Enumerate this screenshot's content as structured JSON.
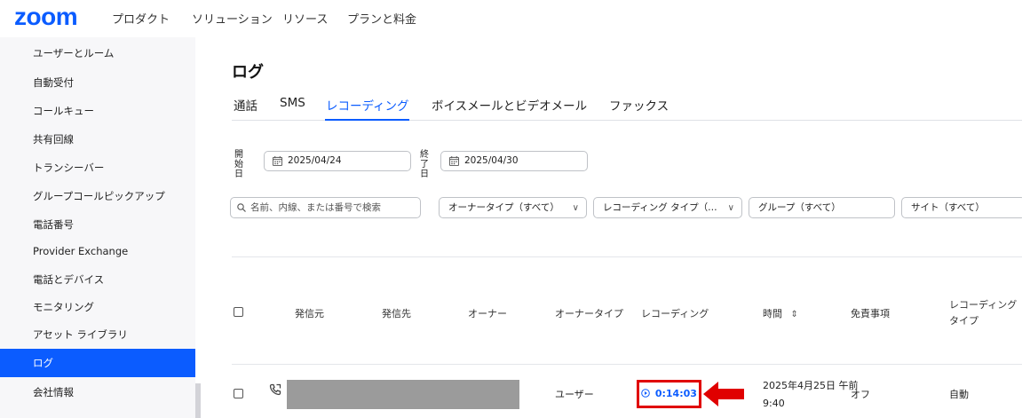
{
  "header": {
    "logo": "zoom",
    "nav": [
      "プロダクト",
      "ソリューション",
      "リソース",
      "プランと料金"
    ]
  },
  "sidebar": {
    "items": [
      {
        "label": "ユーザーとルーム",
        "active": false
      },
      {
        "label": "自動受付",
        "active": false
      },
      {
        "label": "コールキュー",
        "active": false
      },
      {
        "label": "共有回線",
        "active": false
      },
      {
        "label": "トランシーバー",
        "active": false
      },
      {
        "label": "グループコールピックアップ",
        "active": false
      },
      {
        "label": "電話番号",
        "active": false
      },
      {
        "label": "Provider Exchange",
        "active": false
      },
      {
        "label": "電話とデバイス",
        "active": false
      },
      {
        "label": "モニタリング",
        "active": false
      },
      {
        "label": "アセット ライブラリ",
        "active": false
      },
      {
        "label": "ログ",
        "active": true
      },
      {
        "label": "会社情報",
        "active": false
      }
    ]
  },
  "main": {
    "title": "ログ",
    "tabs": [
      {
        "label": "通話",
        "active": false
      },
      {
        "label": "SMS",
        "active": false
      },
      {
        "label": "レコーディング",
        "active": true
      },
      {
        "label": "ボイスメールとビデオメール",
        "active": false
      },
      {
        "label": "ファックス",
        "active": false
      }
    ],
    "start_label_1": "開始",
    "start_label_2": "日",
    "start_date": "2025/04/24",
    "end_label_1": "終了",
    "end_label_2": "日",
    "end_date": "2025/04/30",
    "search_placeholder": "名前、内線、または番号で検索",
    "filters": {
      "owner_type": "オーナータイプ（すべて）",
      "recording_type": "レコーディング タイプ（…",
      "group": "グループ（すべて）",
      "site": "サイト（すべて）"
    },
    "columns": {
      "from": "発信元",
      "to": "発信先",
      "owner": "オーナー",
      "owner_type": "オーナータイプ",
      "recording": "レコーディング",
      "time": "時間",
      "sort_symbol": "⇕",
      "disclaimer": "免責事項",
      "recording_type_1": "レコーディング",
      "recording_type_2": "タイプ"
    },
    "rows": [
      {
        "owner_type": "ユーザー",
        "recording": "0:14:03",
        "time_1": "2025年4月25日 午前",
        "time_2": "9:40",
        "disclaimer": "オフ",
        "recording_type": "自動"
      }
    ]
  },
  "colors": {
    "accent": "#0b5cff",
    "highlight": "#e00000"
  }
}
